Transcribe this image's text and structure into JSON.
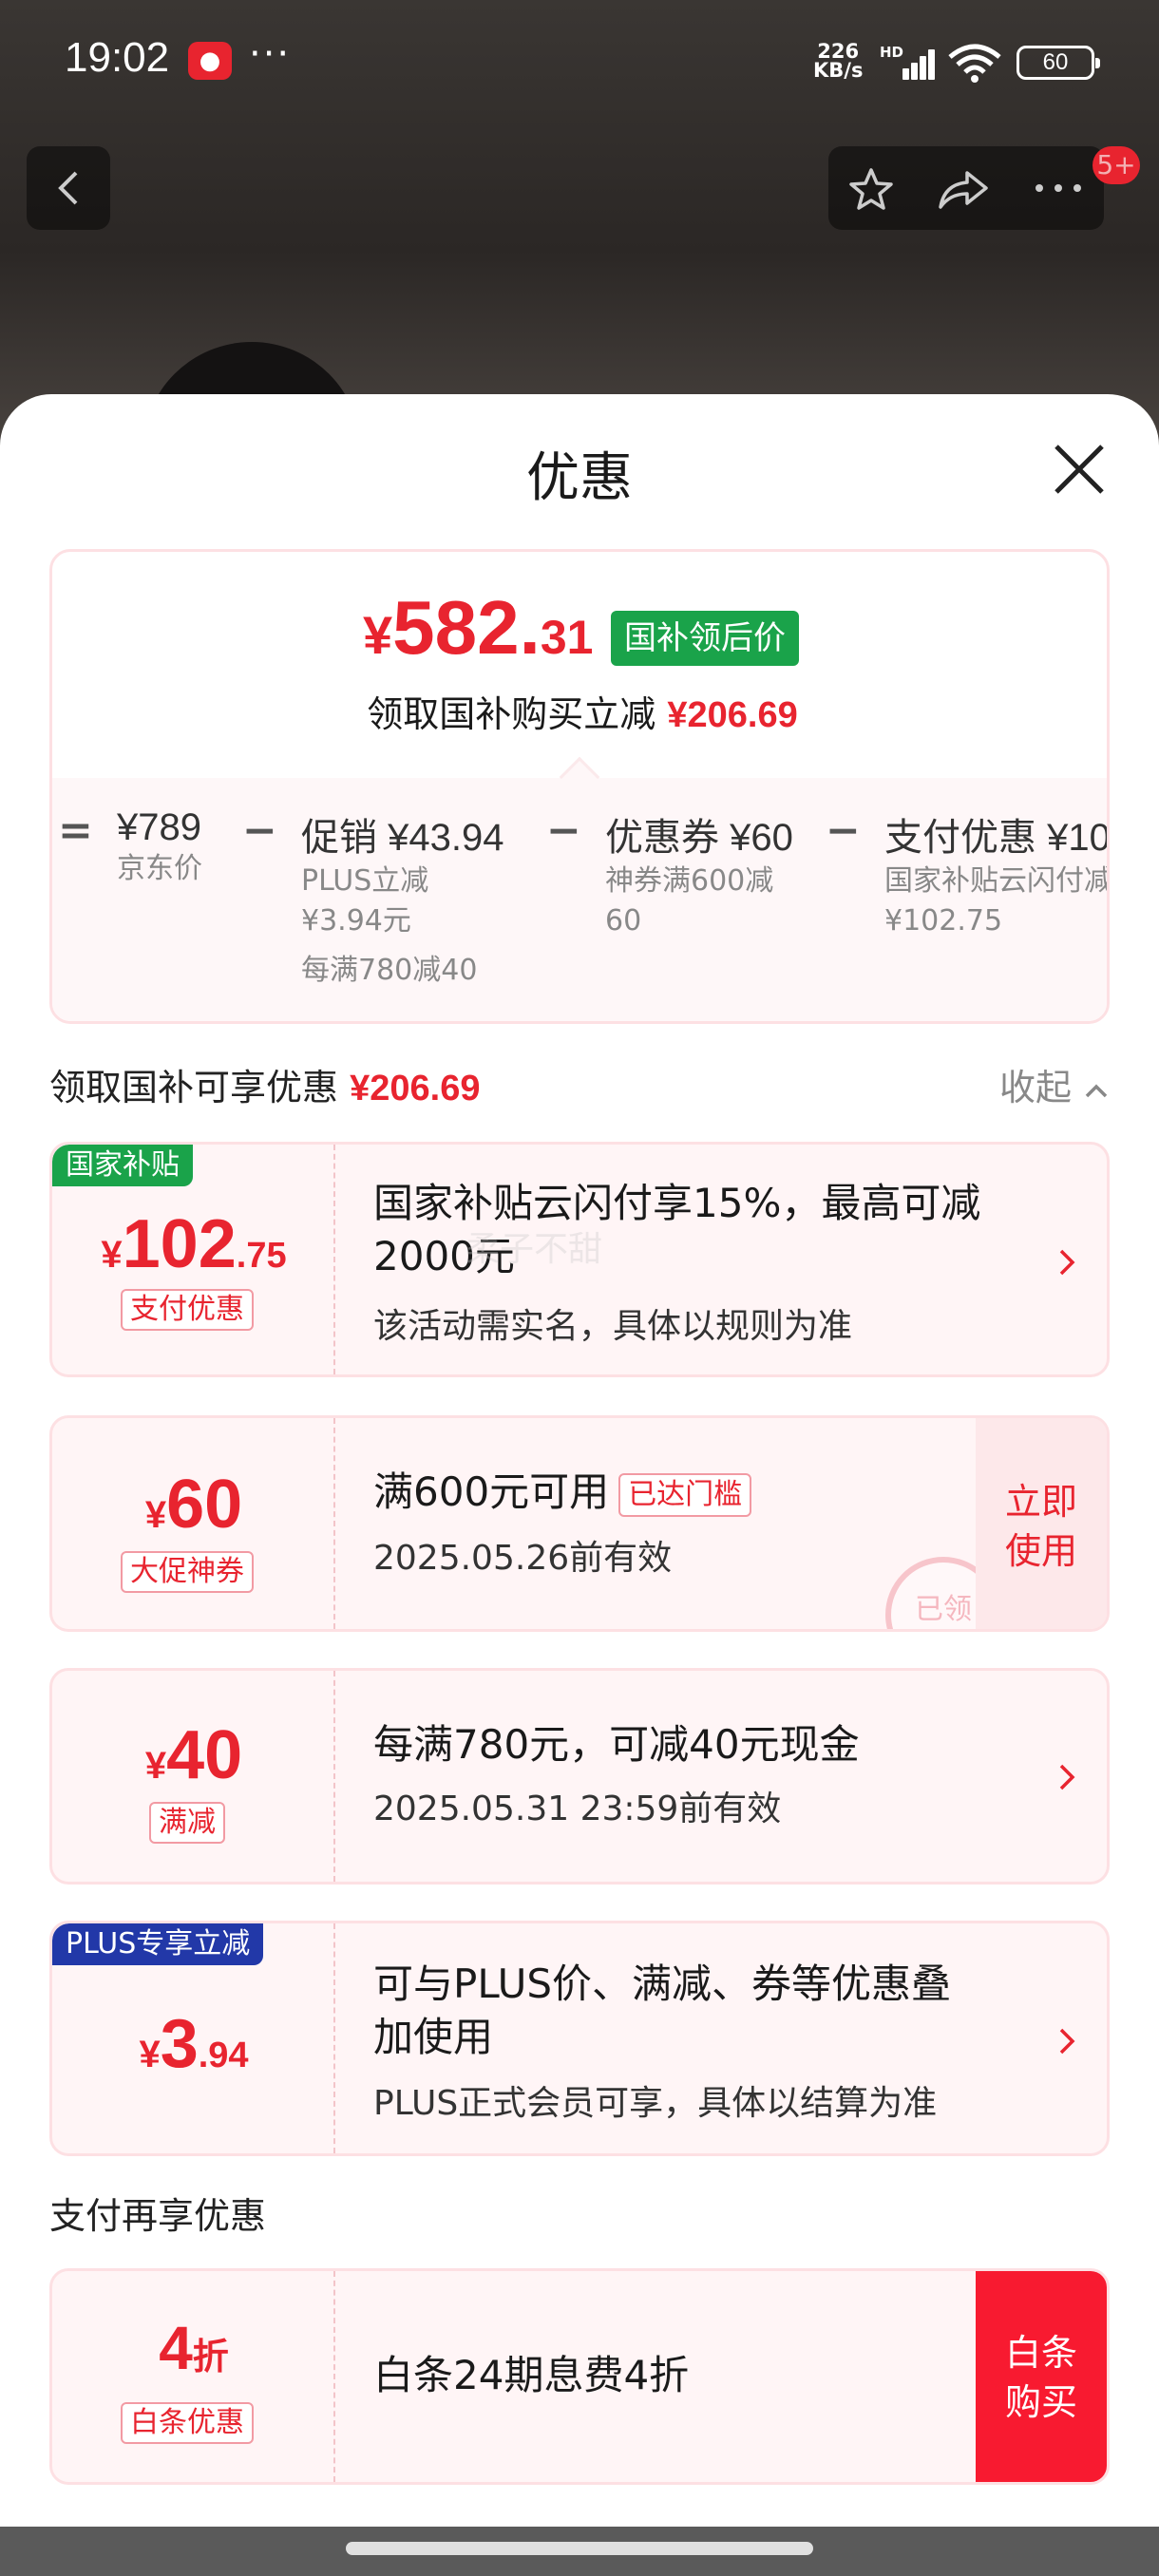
{
  "status_bar": {
    "time": "19:02",
    "app_badge": "📕",
    "more": "···",
    "net_speed_value": "226",
    "net_speed_unit": "KB/s",
    "hd": "HD",
    "battery": "60"
  },
  "nav": {
    "back_icon": "chevron-left-icon",
    "favorite_icon": "star-icon",
    "share_icon": "share-icon",
    "more_icon": "more-icon",
    "badge": "5+"
  },
  "sheet": {
    "title": "优惠",
    "close_icon": "close-icon"
  },
  "price_summary": {
    "currency": "¥",
    "price_int": "582.",
    "price_dec": "31",
    "tag": "国补领后价",
    "subtitle": "领取国补购买立减",
    "subtitle_amount": "¥206.69",
    "breakdown": {
      "equals": "=",
      "minus": "−",
      "jd_price": "¥789",
      "jd_label": "京东价",
      "promo_main": "促销 ¥43.94",
      "promo_sub1": "PLUS立减",
      "promo_sub2": "¥3.94元",
      "promo_sub3": "每满780减40",
      "coupon_main": "优惠券 ¥60",
      "coupon_sub1": "神券满600减",
      "coupon_sub2": "60",
      "pay_main": "支付优惠 ¥10",
      "pay_sub1": "国家补贴云闪付减",
      "pay_sub2": "¥102.75"
    }
  },
  "section_gov": {
    "title": "领取国补可享优惠",
    "amount": "¥206.69",
    "collapse": "收起"
  },
  "watermark": "柔子不甜",
  "cards": {
    "gov": {
      "corner": "国家补贴",
      "currency": "¥",
      "int": "102",
      "dec": ".75",
      "tag": "支付优惠",
      "main_line1": "国家补贴云闪付享15%，最高可减",
      "main_line2": "2000元",
      "sub": "该活动需实名，具体以规则为准"
    },
    "coupon": {
      "currency": "¥",
      "int": "60",
      "tag": "大促神券",
      "main": "满600元可用",
      "reached": "已达门槛",
      "sub": "2025.05.26前有效",
      "button": "立即使用",
      "stamp": "已领"
    },
    "discount": {
      "currency": "¥",
      "int": "40",
      "tag": "满减",
      "main": "每满780元，可减40元现金",
      "sub": "2025.05.31 23:59前有效"
    },
    "plus": {
      "corner": "PLUS专享立减",
      "currency": "¥",
      "int": "3",
      "dec": ".94",
      "main_line1": "可与PLUS价、满减、券等优惠叠",
      "main_line2": "加使用",
      "sub": "PLUS正式会员可享，具体以结算为准"
    }
  },
  "section_pay": {
    "title": "支付再享优惠"
  },
  "baitiao": {
    "int": "4",
    "unit": "折",
    "tag": "白条优惠",
    "main": "白条24期息费4折",
    "button": "白条购买"
  },
  "colors": {
    "accent": "#e8242f",
    "gov_green": "#1aa34a",
    "plus_blue": "#2238a8",
    "card_bg": "#fff5f6"
  }
}
